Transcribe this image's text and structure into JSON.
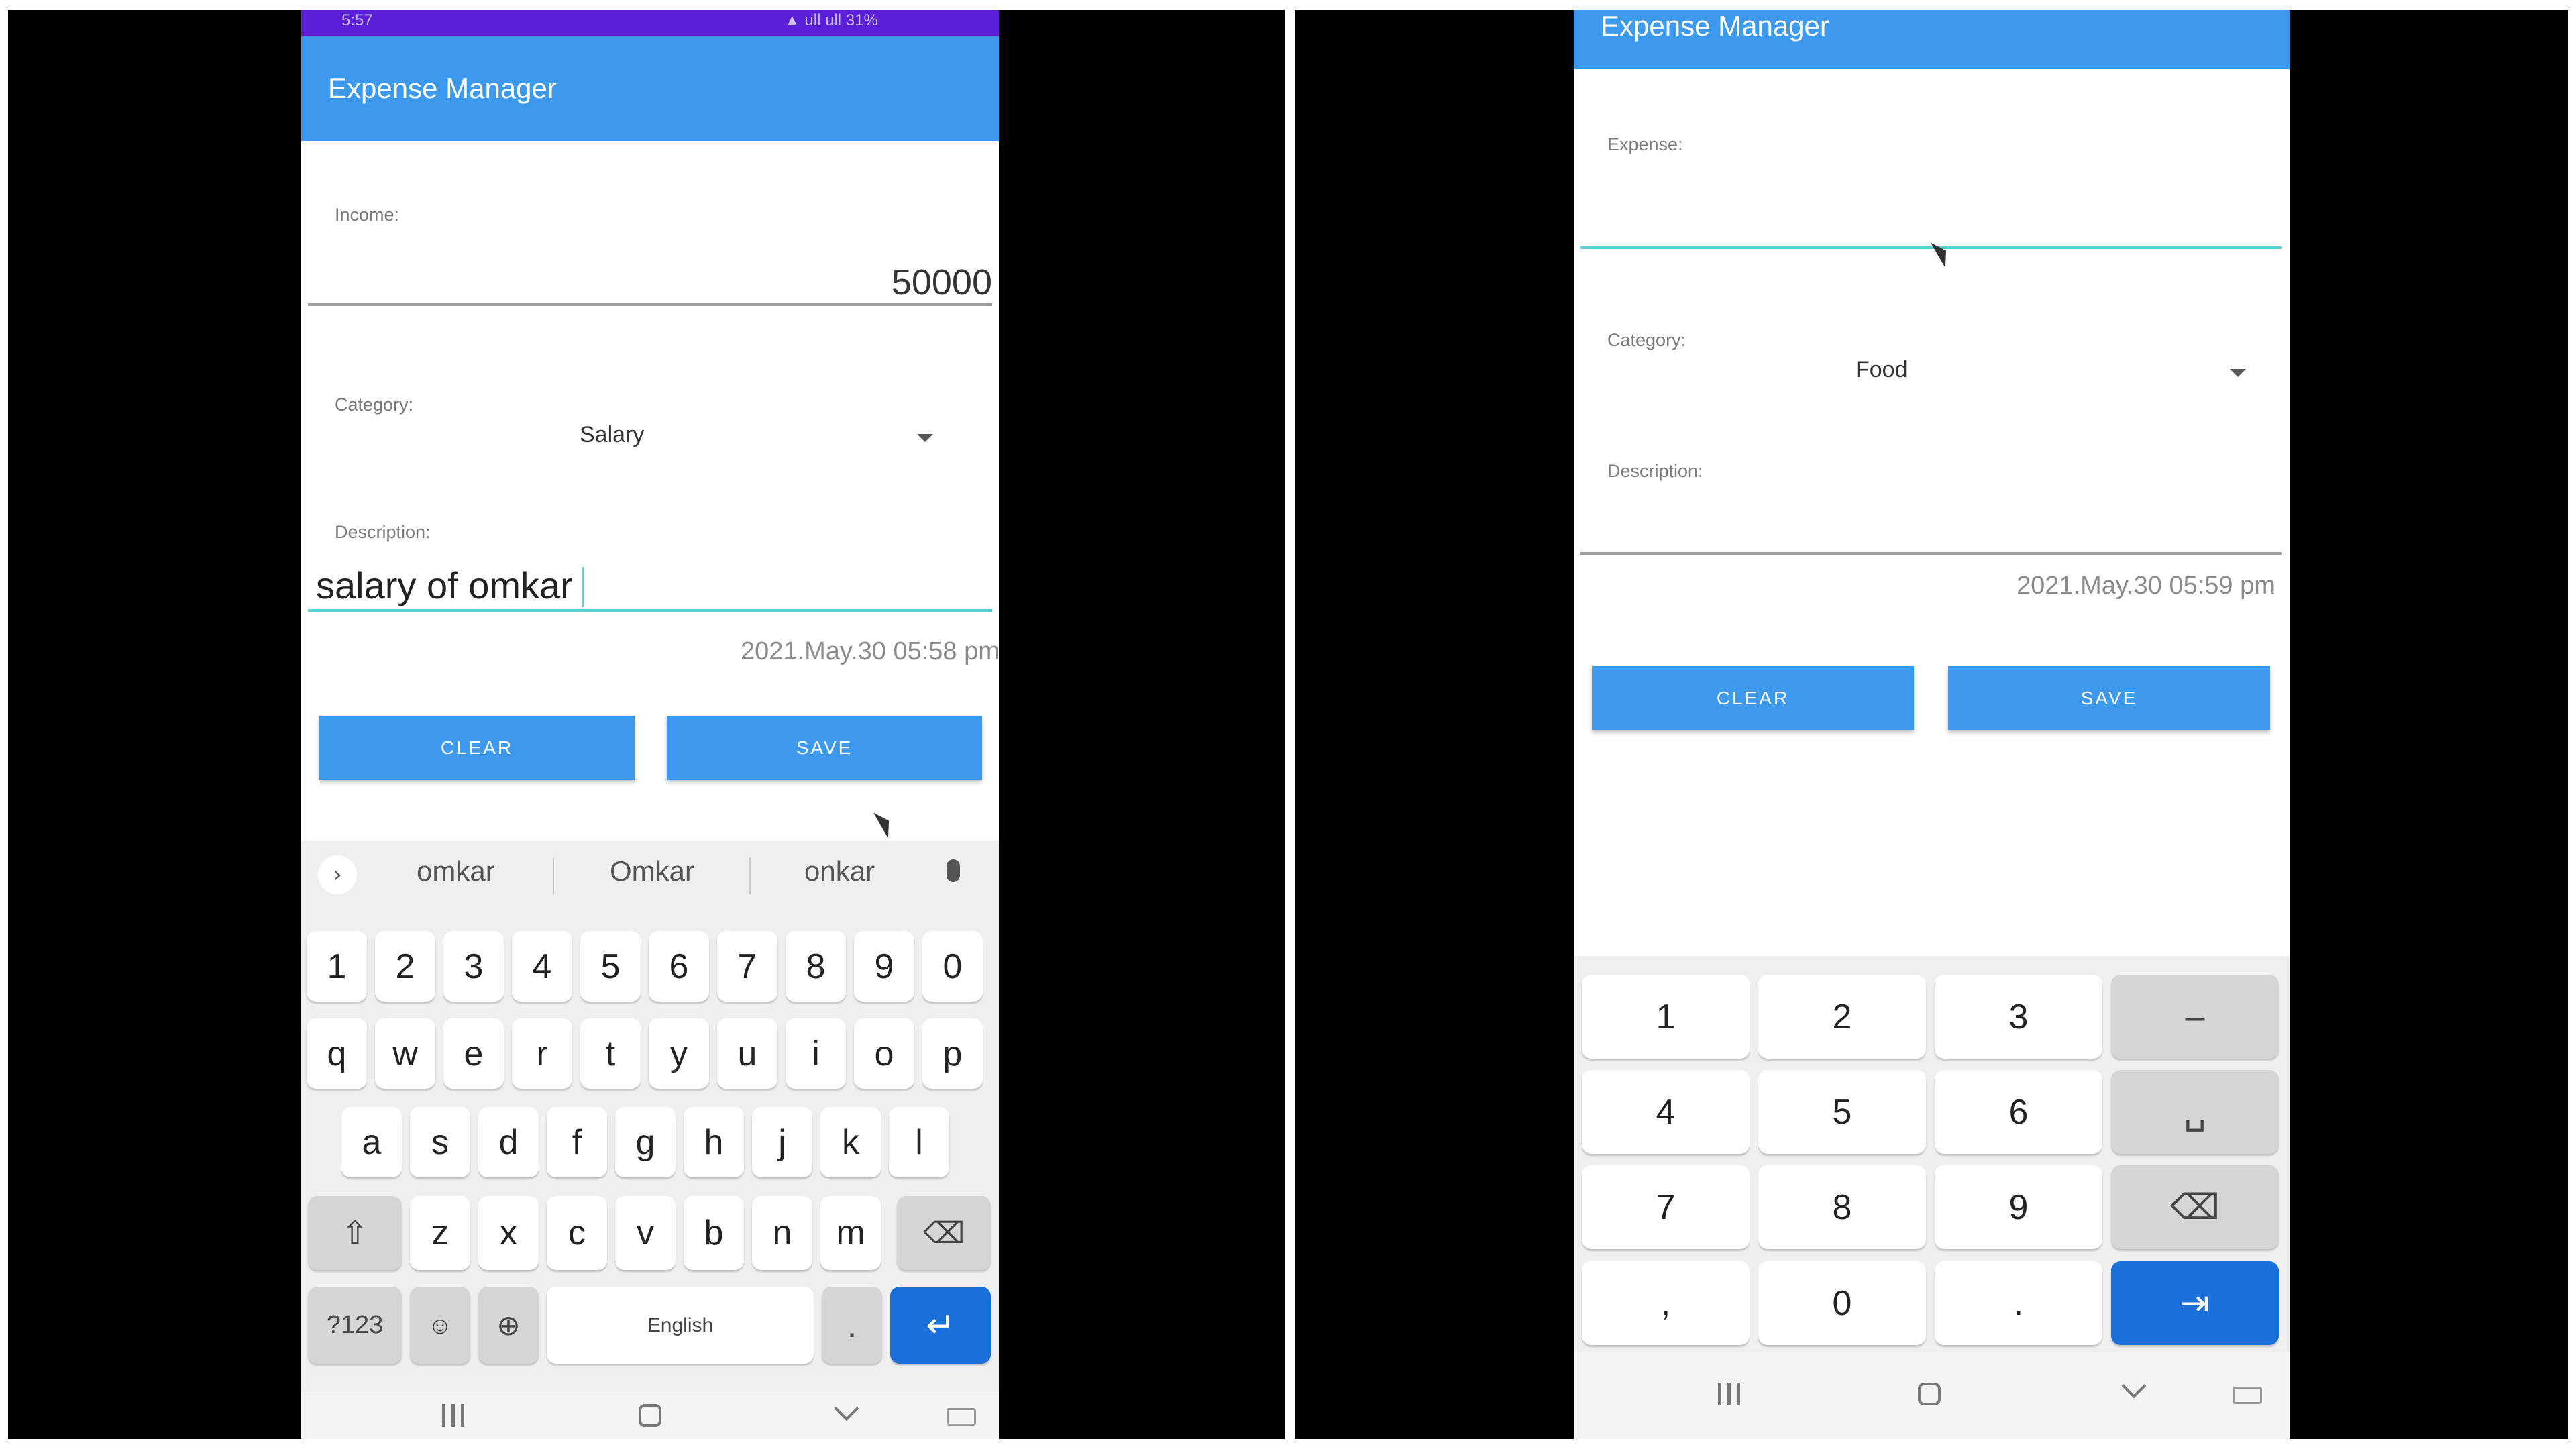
{
  "left": {
    "status_time": "5:57",
    "status_right": "▲ ull ull 31%",
    "app_title": "Expense Manager",
    "income_label": "Income:",
    "income_value": "50000",
    "category_label": "Category:",
    "category_value": "Salary",
    "description_label": "Description:",
    "description_value": "salary of omkar",
    "datetime": "2021.May.30 05:58 pm",
    "clear_button": "CLEAR",
    "save_button": "SAVE",
    "suggestions": [
      "omkar",
      "Omkar",
      "onkar"
    ],
    "keyboard": {
      "numbers": [
        "1",
        "2",
        "3",
        "4",
        "5",
        "6",
        "7",
        "8",
        "9",
        "0"
      ],
      "row1": [
        "q",
        "w",
        "e",
        "r",
        "t",
        "y",
        "u",
        "i",
        "o",
        "p"
      ],
      "row2": [
        "a",
        "s",
        "d",
        "f",
        "g",
        "h",
        "j",
        "k",
        "l"
      ],
      "row3": [
        "z",
        "x",
        "c",
        "v",
        "b",
        "n",
        "m"
      ],
      "sym_key": "?123",
      "space_label": "English",
      "period": "."
    }
  },
  "right": {
    "app_title": "Expense Manager",
    "expense_label": "Expense:",
    "category_label": "Category:",
    "category_value": "Food",
    "description_label": "Description:",
    "datetime": "2021.May.30 05:59 pm",
    "clear_button": "CLEAR",
    "save_button": "SAVE",
    "numpad": {
      "keys": [
        "1",
        "2",
        "3",
        "4",
        "5",
        "6",
        "7",
        "8",
        "9",
        ",",
        "0",
        "."
      ],
      "side_keys": [
        "–",
        "␣",
        "⌫",
        "⇥"
      ]
    }
  },
  "colors": {
    "app_bar": "#3d99ec",
    "status_bar": "#5a1fd6",
    "active_underline": "#5fcfd6",
    "enter_key": "#1a6fd9"
  }
}
